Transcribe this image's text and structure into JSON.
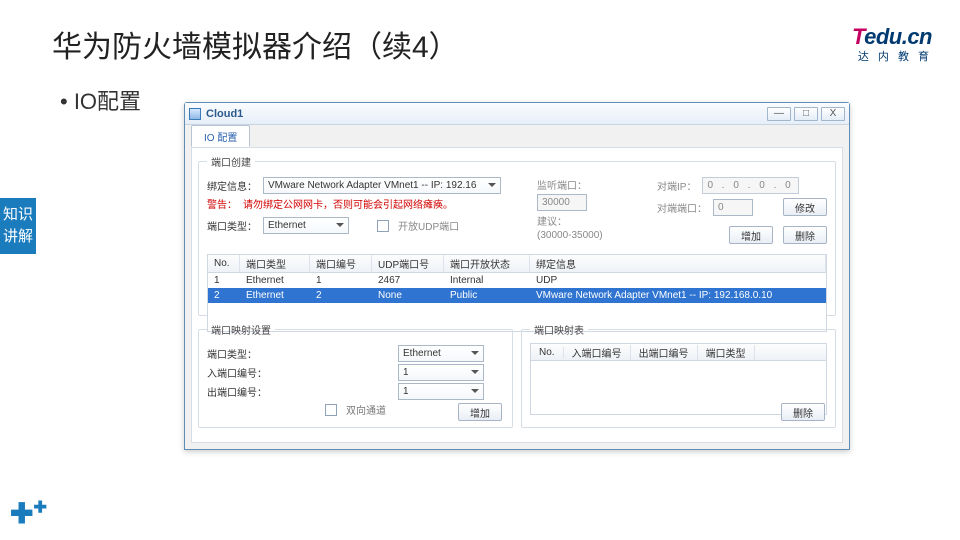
{
  "slide": {
    "title": "华为防火墙模拟器介绍（续4）",
    "bullet": "• IO配置",
    "side_tab": "知识讲解"
  },
  "brand": {
    "t": "T",
    "edu": "edu.cn",
    "sub": "达 内 教 育"
  },
  "win": {
    "title": "Cloud1",
    "min": "—",
    "max": "□",
    "close": "X",
    "tab": "IO 配置",
    "fs_create": "端口创建",
    "bind_lbl": "绑定信息：",
    "bind_val": "VMware Network Adapter VMnet1 -- IP: 192.16",
    "warn_lbl": "警告：",
    "warn_txt": "请勿绑定公网网卡，否则可能会引起网络瘫痪。",
    "ptype_lbl": "端口类型：",
    "ptype_val": "Ethernet",
    "chk_udp": "开放UDP端口",
    "listen_lbl": "监听端口：",
    "listen_val": "30000",
    "range_lbl": "建议：",
    "range_val": "(30000-35000)",
    "remote_ip_lbl": "对端IP：",
    "remote_ip_val": "0 . 0 . 0 . 0",
    "remote_port_lbl": "对端端口：",
    "remote_port_val": "0",
    "btn_modify": "修改",
    "btn_add": "增加",
    "btn_del": "删除",
    "cols": {
      "no": "No.",
      "type": "端口类型",
      "pnum": "端口编号",
      "udp": "UDP端口号",
      "stat": "端口开放状态",
      "bind": "绑定信息"
    },
    "rows": [
      {
        "no": "1",
        "type": "Ethernet",
        "pnum": "1",
        "udp": "2467",
        "stat": "Internal",
        "bind": "UDP"
      },
      {
        "no": "2",
        "type": "Ethernet",
        "pnum": "2",
        "udp": "None",
        "stat": "Public",
        "bind": "VMware Network Adapter VMnet1 -- IP: 192.168.0.10"
      }
    ],
    "fs_mapset": "端口映射设置",
    "m_ptype_lbl": "端口类型：",
    "m_ptype_val": "Ethernet",
    "m_in_lbl": "入端口编号：",
    "m_in_val": "1",
    "m_out_lbl": "出端口编号：",
    "m_out_val": "1",
    "m_chk": "双向通道",
    "fs_maptbl": "端口映射表",
    "mcols": {
      "no": "No.",
      "in": "入端口编号",
      "out": "出端口编号",
      "type": "端口类型"
    }
  },
  "chart_data": null
}
